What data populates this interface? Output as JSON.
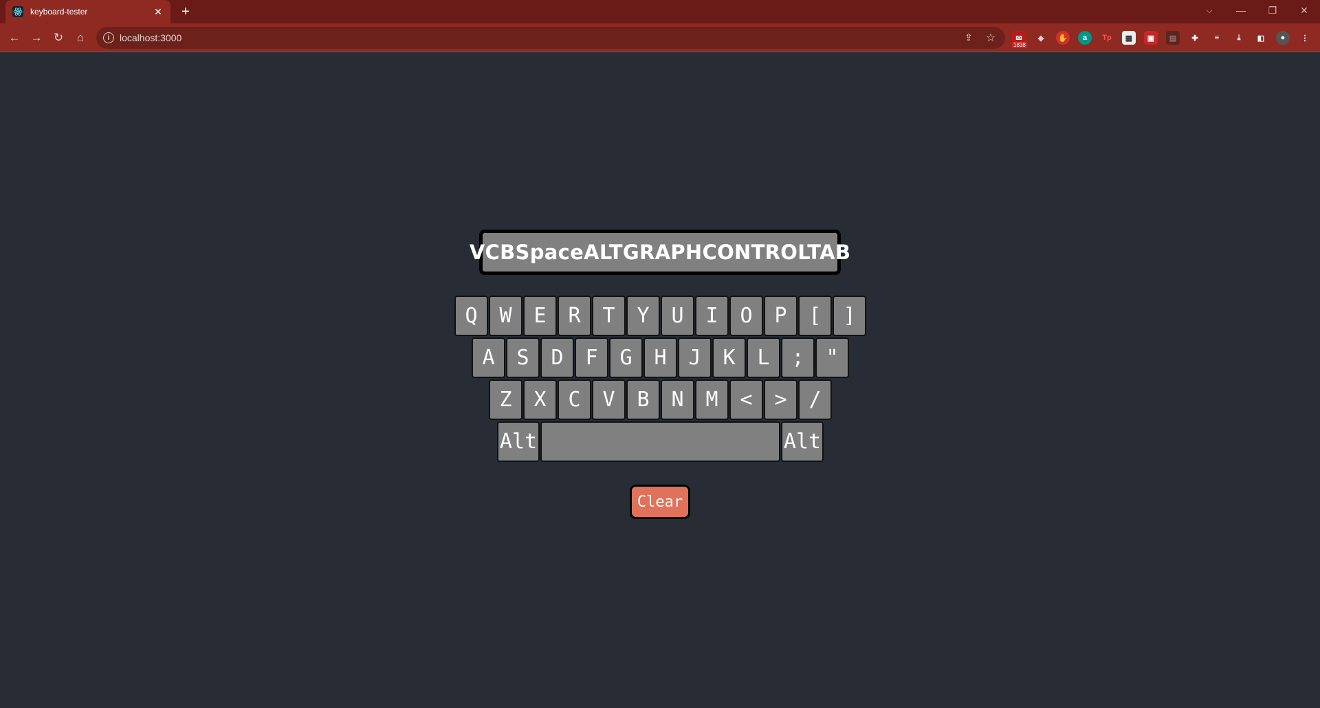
{
  "browser": {
    "tab_title": "keyboard-tester",
    "tab_close": "✕",
    "new_tab": "+",
    "url": "localhost:3000",
    "extension_badge": "1838",
    "controls": {
      "tab_search": "⌵",
      "minimize": "—",
      "restore": "❐",
      "close": "✕"
    }
  },
  "app": {
    "display_text": "VCBSpaceALTGRAPHCONTROLTAB",
    "rows": [
      [
        "Q",
        "W",
        "E",
        "R",
        "T",
        "Y",
        "U",
        "I",
        "O",
        "P",
        "[",
        "]"
      ],
      [
        "A",
        "S",
        "D",
        "F",
        "G",
        "H",
        "J",
        "K",
        "L",
        ";",
        "\""
      ],
      [
        "Z",
        "X",
        "C",
        "V",
        "B",
        "N",
        "M",
        "<",
        ">",
        "/"
      ]
    ],
    "bottom_row": {
      "left_alt": "Alt",
      "space": "",
      "right_alt": "Alt"
    },
    "clear_label": "Clear"
  },
  "colors": {
    "background": "#282c34",
    "key": "#808080",
    "clear_button": "#e0715a",
    "chrome_tab": "#8e2a22",
    "chrome_bar": "#6a1b17"
  }
}
